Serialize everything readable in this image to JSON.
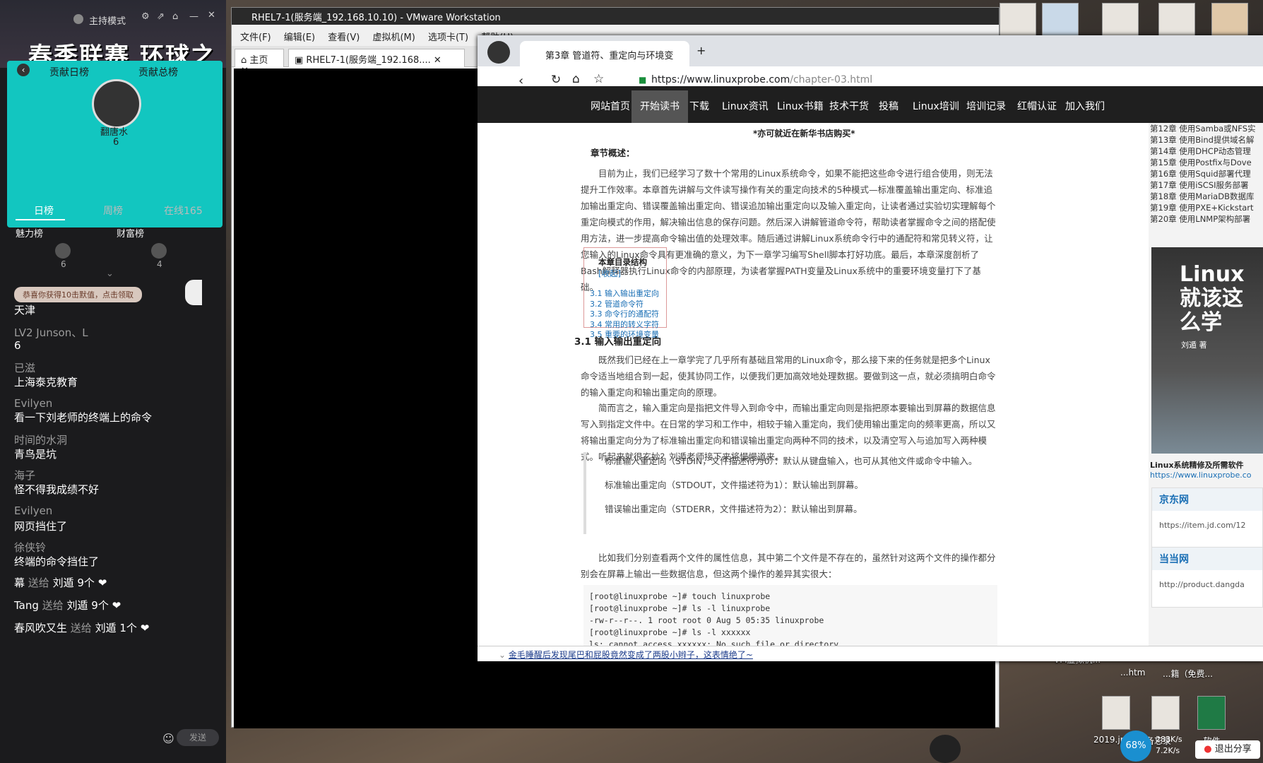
{
  "live": {
    "host_mode": "主持模式",
    "banner": "春季联赛 环球之旅",
    "rank_tabs": [
      "贡献日榜",
      "贡献总榜"
    ],
    "top_user": {
      "name": "翻唐水",
      "score": "6"
    },
    "tabs": [
      "日榜",
      "周榜",
      "在线165"
    ],
    "lists": [
      {
        "label": "魅力榜",
        "count": "6"
      },
      {
        "label": "财富榜",
        "count": "4"
      }
    ],
    "notice": "恭喜你获得10击默值，点击领取",
    "chat": [
      {
        "user": "",
        "msg": "天津"
      },
      {
        "user": "LV2  Junson、L",
        "msg": "6"
      },
      {
        "user": "已滋",
        "msg": "上海泰克教育"
      },
      {
        "user": "Evilyen",
        "msg": "看一下刘老师的终端上的命令"
      },
      {
        "user": "时间的水洞",
        "msg": "青鸟是坑"
      },
      {
        "user": "海子",
        "msg": "怪不得我成绩不好"
      },
      {
        "user": "Evilyen",
        "msg": "网页挡住了"
      },
      {
        "user": "徐侠铃",
        "msg": "终端的命令挡住了"
      }
    ],
    "gifts": [
      {
        "from": "幕",
        "verb": "送给",
        "to": "刘遁",
        "count": "9个"
      },
      {
        "from": "Tang",
        "verb": "送给",
        "to": "刘遁",
        "count": "9个"
      },
      {
        "from": "春风吹又生",
        "verb": "送给",
        "to": "刘遁",
        "count": "1个"
      }
    ],
    "send": "发送"
  },
  "vmware": {
    "title": "RHEL7-1(服务端_192.168.10.10) - VMware Workstation",
    "menu": [
      "文件(F)",
      "编辑(E)",
      "查看(V)",
      "虚拟机(M)",
      "选项卡(T)",
      "帮助(H)"
    ],
    "tabs": [
      {
        "label": "主页"
      },
      {
        "label": "RHEL7-1(服务端_192.168...."
      }
    ]
  },
  "browser": {
    "tab_title": "第3章 管道符、重定向与环境变",
    "url_host": "https://www.linuxprobe.com",
    "url_path": "/chapter-03.html",
    "nav": [
      "网站首页",
      "开始读书",
      "下载",
      "Linux资讯",
      "Linux书籍",
      "技术干货",
      "投稿",
      "Linux培训",
      "培训记录",
      "红帽认证",
      "加入我们"
    ],
    "nav_active": 1
  },
  "article": {
    "top_note": "*亦可就近在新华书店购买*",
    "overview_title": "章节概述：",
    "overview": "目前为止，我们已经学习了数十个常用的Linux系统命令，如果不能把这些命令进行组合使用，则无法提升工作效率。本章首先讲解与文件读写操作有关的重定向技术的5种模式—标准覆盖输出重定向、标准追加输出重定向、错误覆盖输出重定向、错误追加输出重定向以及输入重定向，让读者通过实验切实理解每个重定向模式的作用，解决输出信息的保存问题。然后深入讲解管道命令符，帮助读者掌握命令之间的搭配使用方法，进一步提高命令输出值的处理效率。随后通过讲解Linux系统命令行中的通配符和常见转义符，让您输入的Linux命令具有更准确的意义，为下一章学习编写Shell脚本打好功底。最后，本章深度剖析了Bash解释器执行Linux命令的内部原理，为读者掌握PATH变量及Linux系统中的重要环境变量打下了基础。",
    "toc_title": "本章目录结构",
    "toc_toggle": "[收起]",
    "toc": [
      "3.1 输入输出重定向",
      "3.2 管道命令符",
      "3.3 命令行的通配符",
      "3.4 常用的转义字符",
      "3.5 重要的环境变量"
    ],
    "section_title": "3.1 输入输出重定向",
    "p1": "既然我们已经在上一章学完了几乎所有基础且常用的Linux命令，那么接下来的任务就是把多个Linux命令适当地组合到一起，使其协同工作，以便我们更加高效地处理数据。要做到这一点，就必须搞明白命令的输入重定向和输出重定向的原理。",
    "p2": "简而言之，输入重定向是指把文件导入到命令中，而输出重定向则是指把原本要输出到屏幕的数据信息写入到指定文件中。在日常的学习和工作中，相较于输入重定向，我们使用输出重定向的频率更高，所以又将输出重定向分为了标准输出重定向和错误输出重定向两种不同的技术，以及清空写入与追加写入两种模式。听起来就很玄妙？刘遁老师接下来将慢慢道来。",
    "quotes": [
      "标准输入重定向（STDIN，文件描述符为0）：默认从键盘输入，也可从其他文件或命令中输入。",
      "标准输出重定向（STDOUT，文件描述符为1）：默认输出到屏幕。",
      "错误输出重定向（STDERR，文件描述符为2）：默认输出到屏幕。"
    ],
    "p3": "比如我们分别查看两个文件的属性信息，其中第二个文件是不存在的，虽然针对这两个文件的操作都分别会在屏幕上输出一些数据信息，但这两个操作的差异其实很大：",
    "code": [
      "[root@linuxprobe ~]# touch linuxprobe",
      "[root@linuxprobe ~]# ls -l linuxprobe",
      "-rw-r--r--. 1 root root 0 Aug 5 05:35 linuxprobe",
      "[root@linuxprobe ~]# ls -l xxxxxx",
      "ls: cannot access xxxxxx: No such file or directory"
    ],
    "status_bar": "金毛睡醒后发现尾巴和屁股竟然变成了两股小辫子，这表情绝了~"
  },
  "sidebar": {
    "chapters": [
      "第12章 使用Samba或NFS实",
      "第13章 使用Bind提供域名解",
      "第14章 使用DHCP动态管理",
      "第15章 使用Postfix与Dove",
      "第16章 使用Squid部署代理",
      "第17章 使用iSCSI服务部署",
      "第18章 使用MariaDB数据库",
      "第19章 使用PXE+Kickstart",
      "第20章 使用LNMP架构部署"
    ],
    "book_title": "Linux 就该这么学",
    "book_author": "刘遁 著",
    "book_caption": "Linux系统精修及所需软件",
    "book_link": "https://www.linuxprobe.co",
    "stores": [
      {
        "name": "京东网",
        "link": "https://item.jd.com/12"
      },
      {
        "name": "当当网",
        "link": "http://product.dangda"
      }
    ]
  },
  "desktop": {
    "icons": [
      "VM虚拟机...",
      "...htm",
      "...籍（免费...",
      "2019.jpg",
      "备忘录",
      "...软件..."
    ],
    "net_up": "283K/s",
    "net_down": "7.2K/s",
    "cpu": "68%",
    "share": "退出分享"
  }
}
